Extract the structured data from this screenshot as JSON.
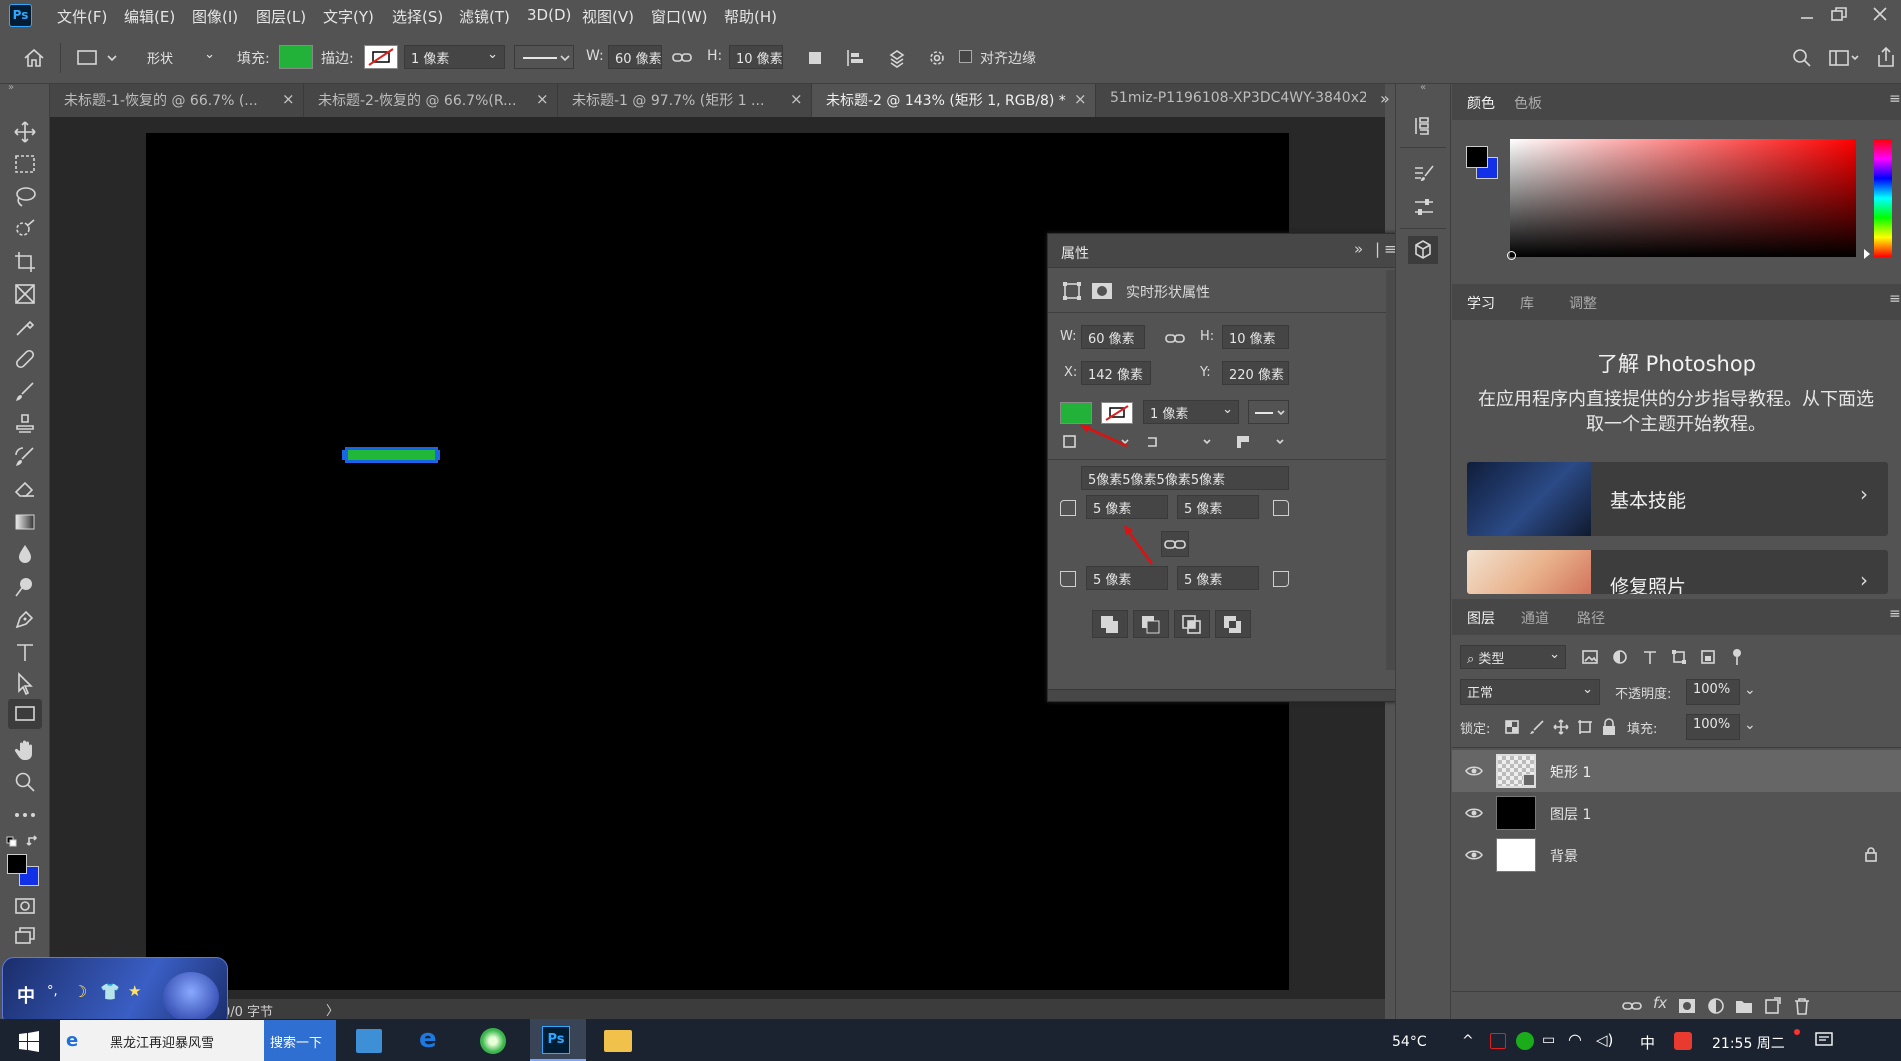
{
  "app": {
    "logo": "Ps"
  },
  "menu": [
    "文件(F)",
    "编辑(E)",
    "图像(I)",
    "图层(L)",
    "文字(Y)",
    "选择(S)",
    "滤镜(T)",
    "3D(D)",
    "视图(V)",
    "窗口(W)",
    "帮助(H)"
  ],
  "options": {
    "mode": "形状",
    "fill_label": "填充:",
    "stroke_label": "描边:",
    "stroke_width": "1 像素",
    "w_label": "W:",
    "w_value": "60 像素",
    "h_label": "H:",
    "h_value": "10 像素",
    "align_edges": "对齐边缘",
    "fill_color": "#22b23a"
  },
  "tabs": [
    {
      "label": "未标题-1-恢复的 @ 66.7% (...",
      "close": "×"
    },
    {
      "label": "未标题-2-恢复的 @ 66.7%(R...",
      "close": "×"
    },
    {
      "label": "未标题-1 @ 97.7% (矩形 1 ...",
      "close": "×"
    },
    {
      "label": "未标题-2 @ 143% (矩形 1, RGB/8) *",
      "close": "×"
    },
    {
      "label": "51miz-P1196108-XP3DC4WY-3840x2",
      "close": ""
    }
  ],
  "tabs_overflow": "»",
  "status": {
    "doc_size": "0/0 字节"
  },
  "properties": {
    "title": "属性",
    "subtitle": "实时形状属性",
    "w_label": "W:",
    "w_value": "60 像素",
    "h_label": "H:",
    "h_value": "10 像素",
    "x_label": "X:",
    "x_value": "142 像素",
    "y_label": "Y:",
    "y_value": "220 像素",
    "stroke_width": "1 像素",
    "corners_all": "5像素5像素5像素5像素",
    "corner_tl": "5 像素",
    "corner_tr": "5 像素",
    "corner_bl": "5 像素",
    "corner_br": "5 像素"
  },
  "color_panel": {
    "tabs": [
      "颜色",
      "色板"
    ],
    "fg": "#000000",
    "bg": "#1230e8"
  },
  "learn": {
    "tabs": [
      "学习",
      "库",
      "调整"
    ],
    "title": "了解 Photoshop",
    "desc": "在应用程序内直接提供的分步指导教程。从下面选取一个主题开始教程。",
    "cards": [
      {
        "label": "基本技能"
      },
      {
        "label": "修复照片"
      }
    ]
  },
  "layers": {
    "tabs": [
      "图层",
      "通道",
      "路径"
    ],
    "filter_label": "类型",
    "blend_mode": "正常",
    "opacity_label": "不透明度:",
    "opacity": "100%",
    "lock_label": "锁定:",
    "fill_label": "填充:",
    "fill": "100%",
    "items": [
      {
        "name": "矩形 1",
        "selected": true
      },
      {
        "name": "图层 1",
        "selected": false
      },
      {
        "name": "背景",
        "selected": false,
        "locked": true
      }
    ]
  },
  "ime": {
    "mode": "中"
  },
  "taskbar": {
    "search_text": "黑龙江再迎暴风雪",
    "search_button": "搜索一下",
    "temp": "54°C",
    "time": "21:55 周二",
    "tray_ime": "中"
  }
}
